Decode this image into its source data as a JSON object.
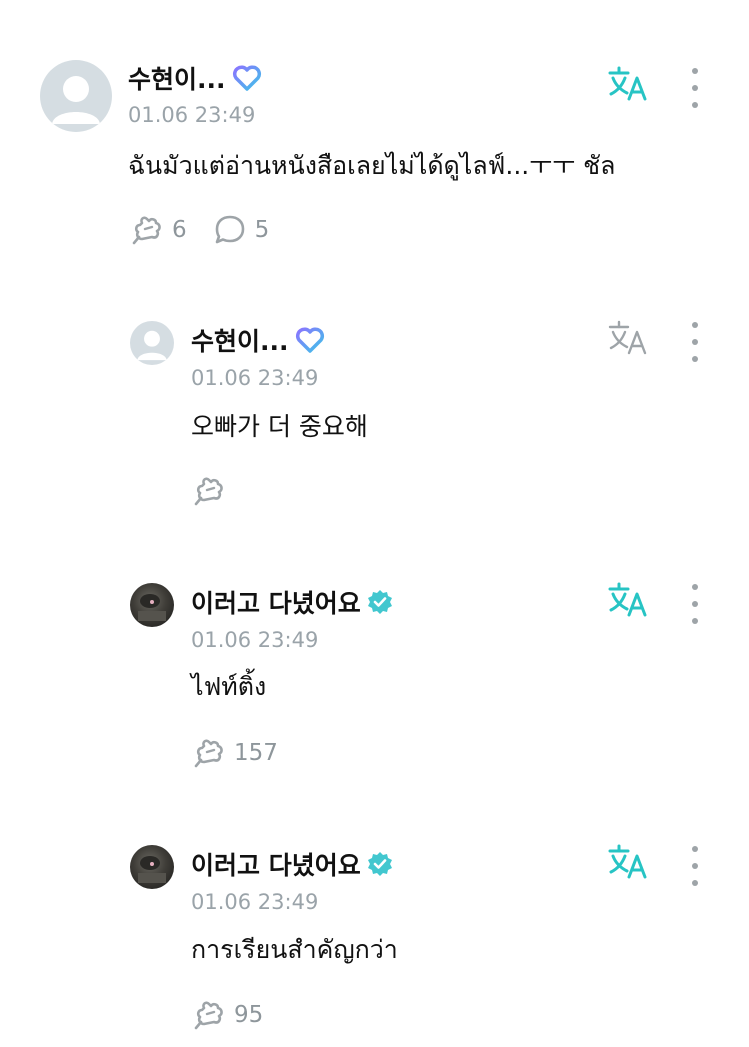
{
  "comments": [
    {
      "author": "수현이...",
      "badge": "heart-badge",
      "time": "01.06 23:49",
      "text": "ฉันมัวแต่อ่านหนังสือเลยไม่ได้ดูไลฟ์...ㅜㅜ ชัล",
      "likes": "6",
      "replies": "5",
      "translate_active": true,
      "avatar": "default-avatar"
    },
    {
      "author": "수현이...",
      "badge": "heart-badge",
      "time": "01.06 23:49",
      "text": "오빠가 더 중요해",
      "likes": "",
      "translate_active": false,
      "avatar": "default-avatar"
    },
    {
      "author": "이러고 다녔어요",
      "badge": "verified-badge",
      "time": "01.06 23:49",
      "text": "ไฟท์ติ้ง",
      "likes": "157",
      "translate_active": true,
      "avatar": "photo-avatar"
    },
    {
      "author": "이러고 다녔어요",
      "badge": "verified-badge",
      "time": "01.06 23:49",
      "text": "การเรียนสำคัญกว่า",
      "likes": "95",
      "translate_active": true,
      "avatar": "photo-avatar"
    }
  ],
  "colors": {
    "accent": "#27c4c4",
    "muted": "#9aa3a9",
    "heart_start": "#7e7cff",
    "heart_end": "#3fc3e8",
    "verified": "#42c7cf"
  }
}
